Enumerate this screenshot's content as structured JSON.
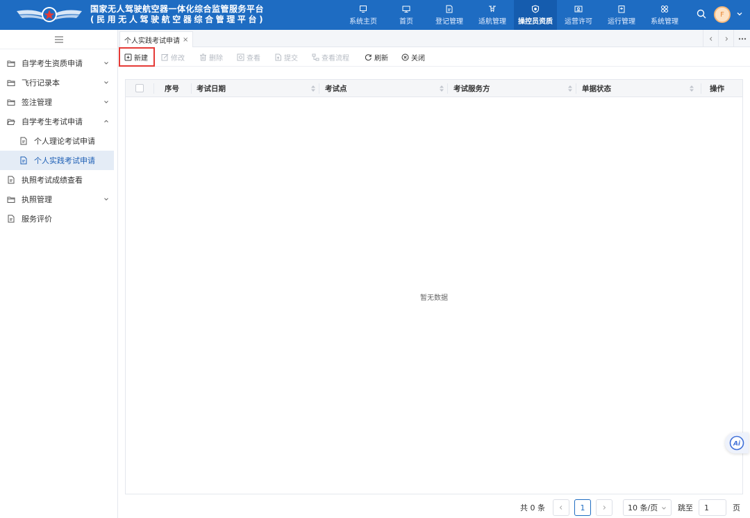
{
  "header": {
    "title_line1": "国家无人驾驶航空器一体化综合监管服务平台",
    "title_line2": "(民用无人驾驶航空器综合管理平台)",
    "avatar_initial": "F",
    "nav": [
      {
        "label": "系统主页",
        "icon": "system-home-icon"
      },
      {
        "label": "首页",
        "icon": "monitor-icon"
      },
      {
        "label": "登记管理",
        "icon": "registration-icon"
      },
      {
        "label": "适航管理",
        "icon": "drone-icon"
      },
      {
        "label": "操控员资质",
        "icon": "shield-icon",
        "active": true
      },
      {
        "label": "运营许可",
        "icon": "license-icon"
      },
      {
        "label": "运行管理",
        "icon": "operation-icon"
      },
      {
        "label": "系统管理",
        "icon": "settings-icon"
      }
    ]
  },
  "sidebar": {
    "items": [
      {
        "label": "自学考生资质申请"
      },
      {
        "label": "飞行记录本"
      },
      {
        "label": "签注管理"
      },
      {
        "label": "自学考生考试申请"
      },
      {
        "label": "个人理论考试申请"
      },
      {
        "label": "个人实践考试申请"
      },
      {
        "label": "执照考试成绩查看"
      },
      {
        "label": "执照管理"
      },
      {
        "label": "服务评价"
      }
    ]
  },
  "tabs": [
    {
      "label": "个人实践考试申请",
      "close": "×"
    }
  ],
  "toolbar": {
    "new": "新建",
    "edit": "修改",
    "delete": "删除",
    "view": "查看",
    "submit": "提交",
    "flow": "查看流程",
    "refresh": "刷新",
    "close": "关闭"
  },
  "table": {
    "columns": [
      "序号",
      "考试日期",
      "考试点",
      "考试服务方",
      "单据状态",
      "操作"
    ],
    "empty_text": "暂无数据"
  },
  "pagination": {
    "total": "共 0 条",
    "current_page": "1",
    "page_size": "10 条/页",
    "goto_label": "跳至",
    "goto_value": "1",
    "page_suffix": "页"
  },
  "ai_badge": "Ai",
  "colors": {
    "header_bg": "#1e6cc2",
    "accent": "#1e6cc2",
    "highlight_border": "#e53935"
  }
}
